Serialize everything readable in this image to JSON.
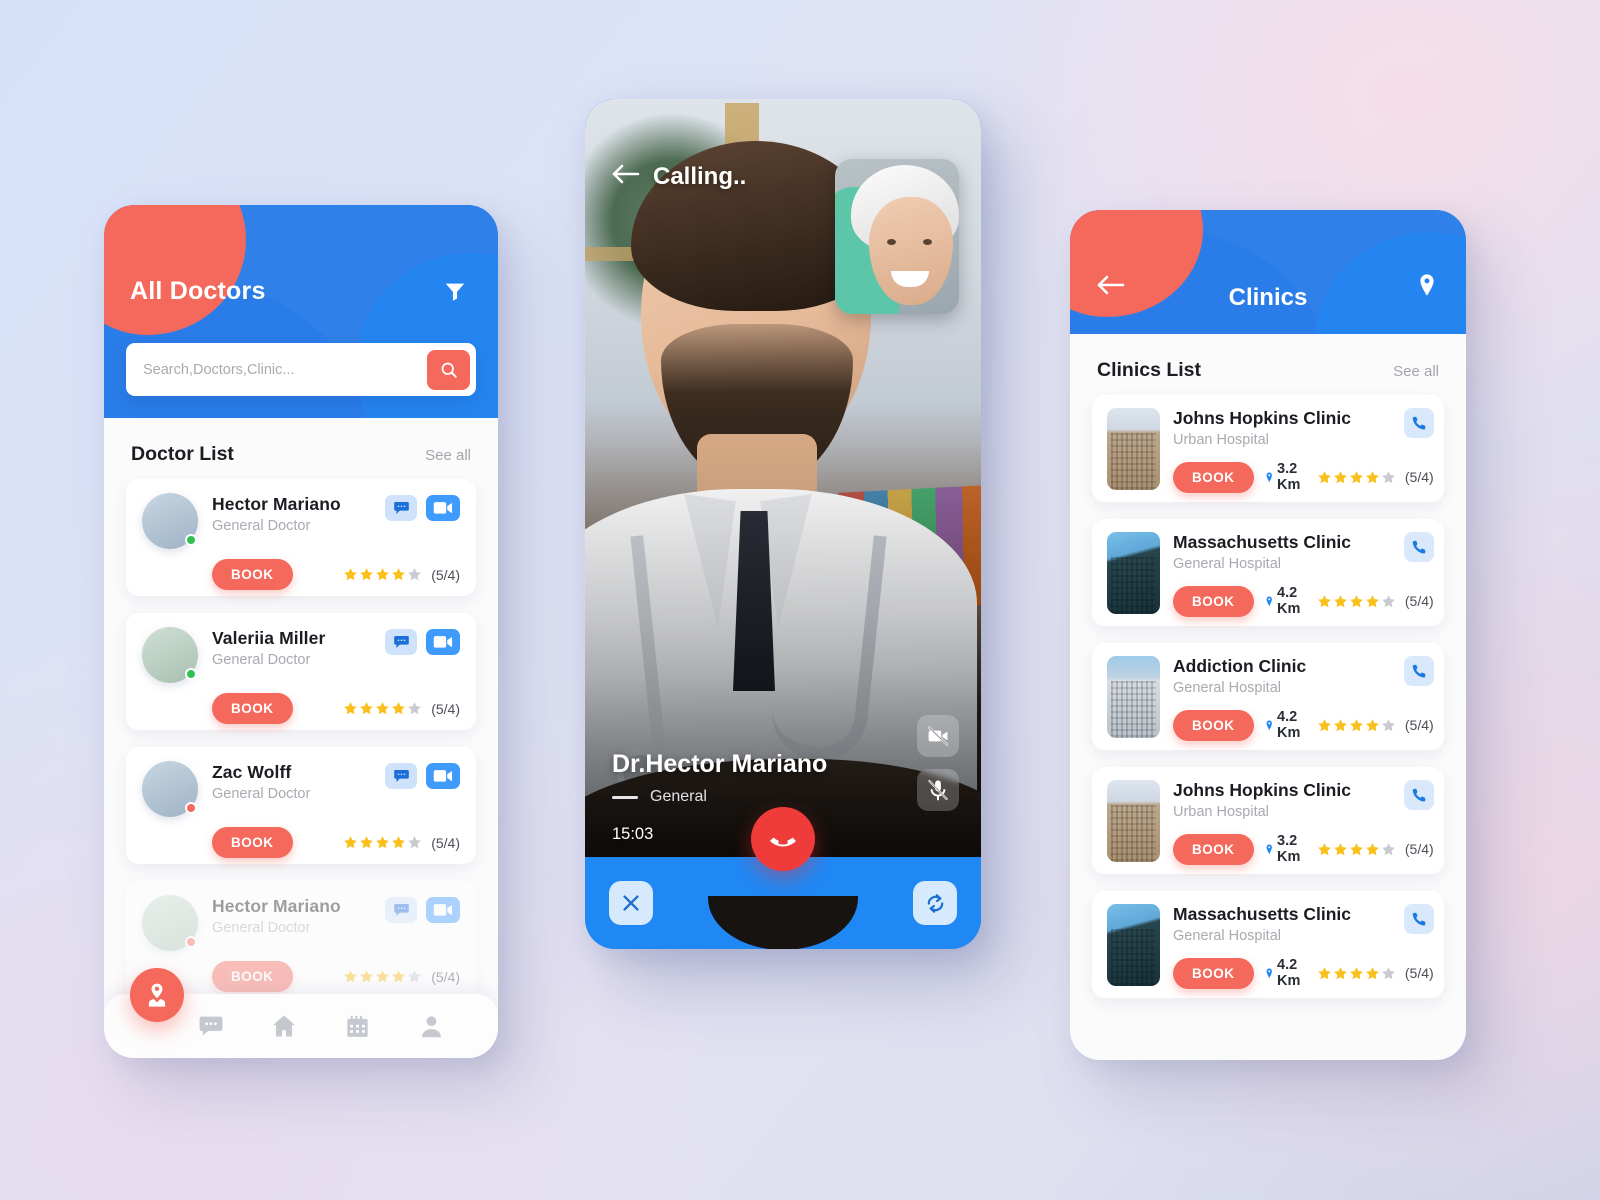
{
  "app": {
    "accent_red": "#f4695c",
    "accent_blue": "#1f88f5",
    "header_blue": "#1558d6",
    "star_gold": "#f9bf1a",
    "star_gray": "#c9cbd1"
  },
  "doctors_screen": {
    "title": "All Doctors",
    "filter_icon": "filter-icon",
    "search": {
      "placeholder": "Search,Doctors,Clinic...",
      "value": "",
      "button_icon": "search-icon"
    },
    "section": {
      "title": "Doctor List",
      "see_all": "See all"
    },
    "doctors": [
      {
        "name": "Hector Mariano",
        "role": "General Doctor",
        "book_label": "BOOK",
        "rating_text": "(5/4)",
        "stars": 4,
        "status": "online",
        "faded": false
      },
      {
        "name": "Valeriia Miller",
        "role": "General Doctor",
        "book_label": "BOOK",
        "rating_text": "(5/4)",
        "stars": 4,
        "status": "online",
        "faded": false
      },
      {
        "name": "Zac Wolff",
        "role": "General Doctor",
        "book_label": "BOOK",
        "rating_text": "(5/4)",
        "stars": 4,
        "status": "busy",
        "faded": false
      },
      {
        "name": "Hector Mariano",
        "role": "General Doctor",
        "book_label": "BOOK",
        "rating_text": "(5/4)",
        "stars": 4,
        "status": "busy",
        "faded": true
      }
    ],
    "fab_icon": "doctor-locator-icon",
    "nav": [
      {
        "icon": "chat-icon",
        "name": "chat"
      },
      {
        "icon": "home-icon",
        "name": "home"
      },
      {
        "icon": "calendar-icon",
        "name": "calendar"
      },
      {
        "icon": "profile-icon",
        "name": "profile"
      }
    ]
  },
  "call_screen": {
    "back_icon": "back-arrow-icon",
    "status_text": "Calling..",
    "doctor_name": "Dr.Hector Mariano",
    "specialty": "General",
    "duration": "15:03",
    "controls": {
      "video_off_icon": "video-off-icon",
      "mic_off_icon": "mic-off-icon",
      "end_call_icon": "end-call-icon",
      "close_icon": "close-icon",
      "switch_camera_icon": "switch-camera-icon"
    }
  },
  "clinics_screen": {
    "back_icon": "back-arrow-icon",
    "title": "Clinics",
    "map_icon": "location-pin-icon",
    "section": {
      "title": "Clinics List",
      "see_all": "See all"
    },
    "clinics": [
      {
        "name": "Johns Hopkins Clinic",
        "type": "Urban Hospital",
        "book_label": "BOOK",
        "distance": "3.2 Km",
        "rating_text": "(5/4)",
        "stars": 4,
        "thumb": "a",
        "call_icon": "phone-icon"
      },
      {
        "name": "Massachusetts Clinic",
        "type": "General Hospital",
        "book_label": "BOOK",
        "distance": "4.2 Km",
        "rating_text": "(5/4)",
        "stars": 4,
        "thumb": "b",
        "call_icon": "phone-icon"
      },
      {
        "name": "Addiction Clinic",
        "type": "General Hospital",
        "book_label": "BOOK",
        "distance": "4.2 Km",
        "rating_text": "(5/4)",
        "stars": 4,
        "thumb": "c",
        "call_icon": "phone-icon"
      },
      {
        "name": "Johns Hopkins Clinic",
        "type": "Urban Hospital",
        "book_label": "BOOK",
        "distance": "3.2 Km",
        "rating_text": "(5/4)",
        "stars": 4,
        "thumb": "a",
        "call_icon": "phone-icon"
      },
      {
        "name": "Massachusetts Clinic",
        "type": "General Hospital",
        "book_label": "BOOK",
        "distance": "4.2 Km",
        "rating_text": "(5/4)",
        "stars": 4,
        "thumb": "b",
        "call_icon": "phone-icon"
      }
    ]
  }
}
